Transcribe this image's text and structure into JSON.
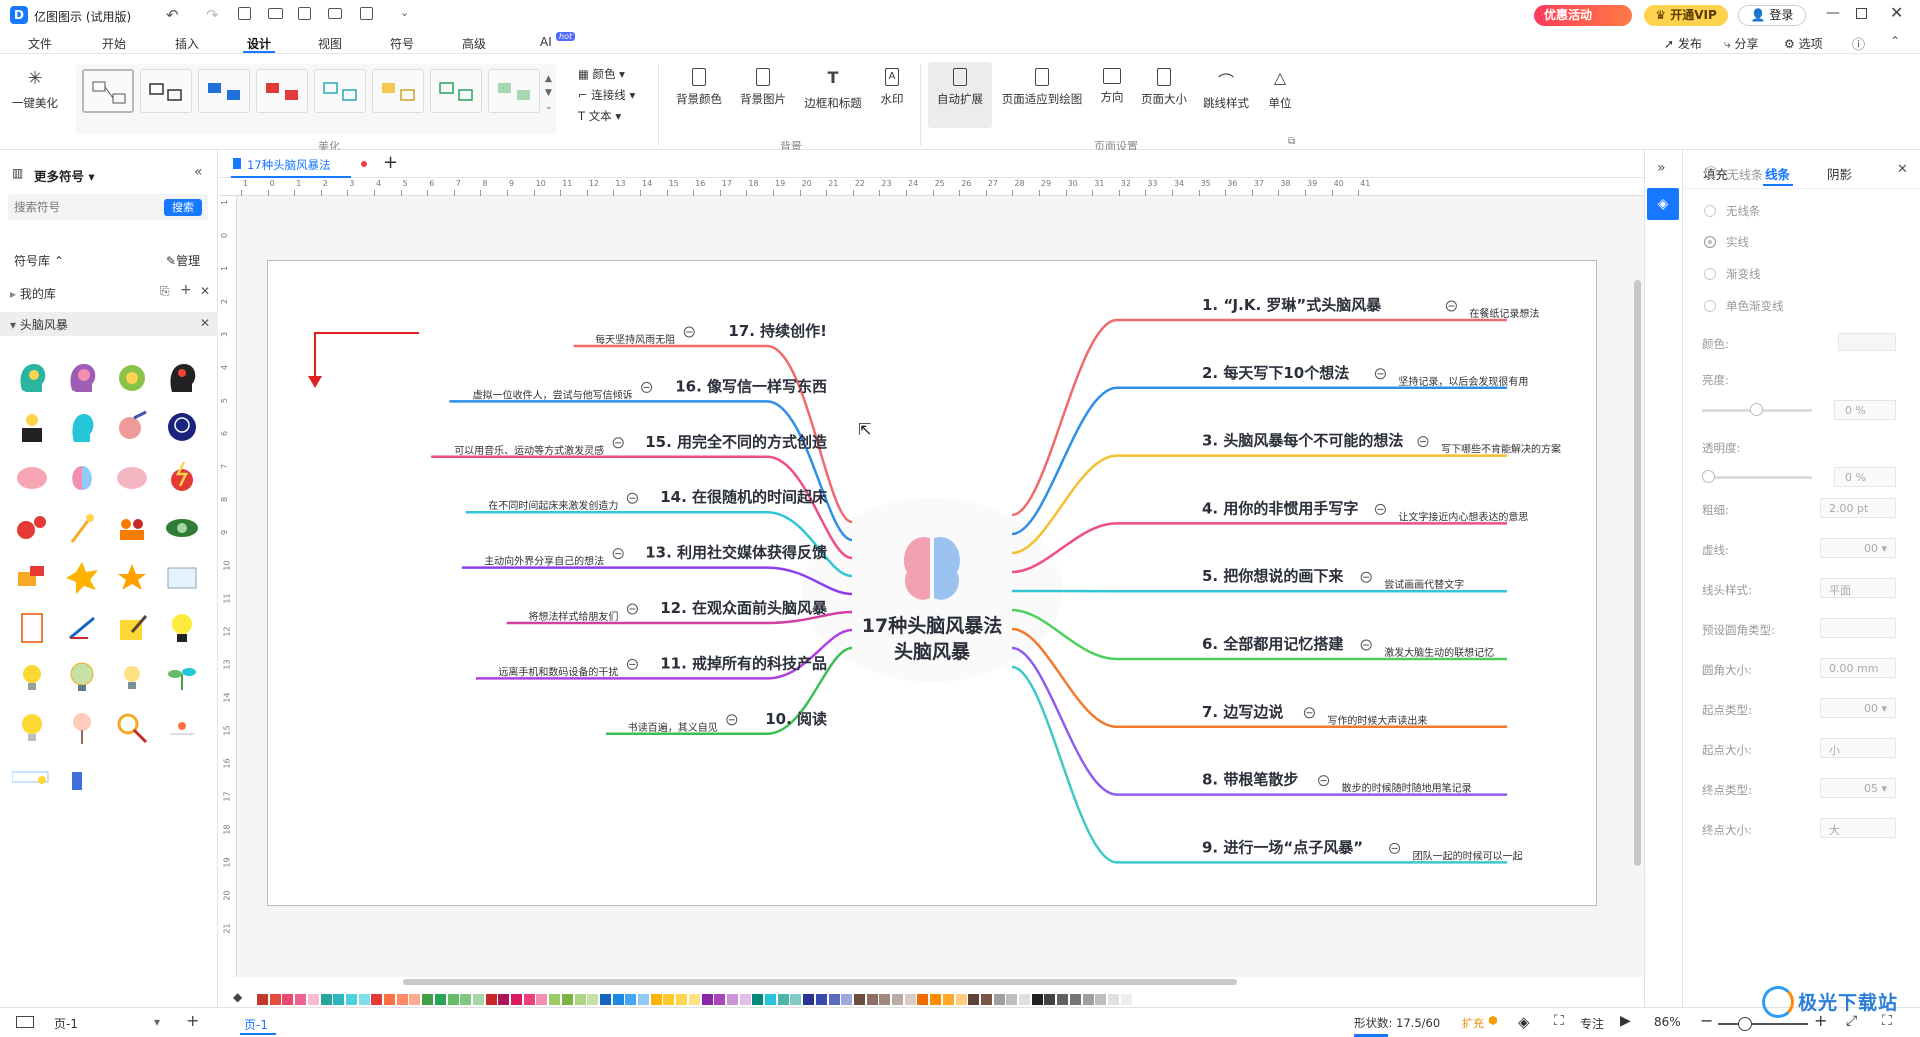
{
  "app": {
    "title": "亿图图示 (试用版)",
    "promo_label": "优惠活动",
    "vip_label": "开通VIP",
    "login_label": "登录",
    "publish_label": "发布",
    "share_label": "分享",
    "options_label": "选项"
  },
  "menu": {
    "items": [
      "文件",
      "开始",
      "插入",
      "设计",
      "视图",
      "符号",
      "高级",
      "AI"
    ],
    "active": "设计",
    "ai_badge": "hot"
  },
  "ribbon": {
    "beautify_label": "一键美化",
    "group_beautify": "美化",
    "color_label": "颜色",
    "connector_label": "连接线",
    "text_label": "文本",
    "bg_color_label": "背景颜色",
    "bg_image_label": "背景图片",
    "border_title_label": "边框和标题",
    "watermark_label": "水印",
    "group_background": "背景",
    "auto_expand_label": "自动扩展",
    "fit_page_label": "页面适应到绘图",
    "direction_label": "方向",
    "page_size_label": "页面大小",
    "jump_style_label": "跳线样式",
    "unit_label": "单位",
    "group_page_setup": "页面设置"
  },
  "left_panel": {
    "header": "更多符号",
    "search_placeholder": "搜索符号",
    "search_button": "搜索",
    "library_label": "符号库",
    "manage_label": "管理",
    "my_library": "我的库",
    "category": "头脑风暴"
  },
  "doc_tab": {
    "title": "17种头脑风暴法"
  },
  "ruler": {
    "h_ticks": [
      "1",
      "0",
      "1",
      "2",
      "3",
      "4",
      "5",
      "6",
      "7",
      "8",
      "9",
      "10",
      "11",
      "12",
      "13",
      "14",
      "15",
      "16",
      "17",
      "18",
      "19",
      "20",
      "21",
      "22",
      "23",
      "24",
      "25",
      "26",
      "27",
      "28",
      "29",
      "30",
      "31",
      "32",
      "33",
      "34",
      "35",
      "36",
      "37",
      "38",
      "39",
      "40",
      "41"
    ],
    "v_ticks": [
      "1",
      "0",
      "1",
      "2",
      "3",
      "4",
      "5",
      "6",
      "7",
      "8",
      "9",
      "10",
      "11",
      "12",
      "13",
      "14",
      "15",
      "16",
      "17",
      "18",
      "19",
      "20",
      "21"
    ]
  },
  "mindmap": {
    "center_line1": "17种头脑风暴法",
    "center_line2": "头脑风暴",
    "right_branches": [
      {
        "title": "1. “J.K. 罗琳”式头脑风暴",
        "note": "在餐纸记录想法",
        "color": "#f06a6a"
      },
      {
        "title": "2. 每天写下10个想法",
        "note": "坚持记录，以后会发现很有用",
        "color": "#2f8fe8"
      },
      {
        "title": "3. 头脑风暴每个不可能的想法",
        "note": "写下哪些不肯能解决的方案",
        "color": "#f5c02f"
      },
      {
        "title": "4. 用你的非惯用手写字",
        "note": "让文字接近内心想表达的意思",
        "color": "#f04c85"
      },
      {
        "title": "5. 把你想说的画下来",
        "note": "尝试画画代替文字",
        "color": "#31c6d4"
      },
      {
        "title": "6. 全部都用记忆搭建",
        "note": "激发大脑生动的联想记忆",
        "color": "#4fcf5a"
      },
      {
        "title": "7. 边写边说",
        "note": "写作的时候大声读出来",
        "color": "#f07a30"
      },
      {
        "title": "8. 带根笔散步",
        "note": "散步的时候随时随地用笔记录",
        "color": "#8f5cf0"
      },
      {
        "title": "9. 进行一场“点子风暴”",
        "note": "团队一起的时候可以一起",
        "color": "#3fc8c8"
      }
    ],
    "left_branches": [
      {
        "title": "17. 持续创作!",
        "note": "每天坚持风雨无阻",
        "color": "#f06a6a"
      },
      {
        "title": "16. 像写信一样写东西",
        "note": "虚拟一位收件人，尝试与他写信倾诉",
        "color": "#2f8fe8"
      },
      {
        "title": "15. 用完全不同的方式创造",
        "note": "可以用音乐、运动等方式激发灵感",
        "color": "#f04c85"
      },
      {
        "title": "14. 在很随机的时间起床",
        "note": "在不同时间起床来激发创造力",
        "color": "#31c6d4"
      },
      {
        "title": "13. 利用社交媒体获得反馈",
        "note": "主动向外界分享自己的想法",
        "color": "#8f3cf0"
      },
      {
        "title": "12. 在观众面前头脑风暴",
        "note": "将想法样式给朋友们",
        "color": "#d040a0"
      },
      {
        "title": "11. 戒掉所有的科技产品",
        "note": "远离手机和数码设备的干扰",
        "color": "#b040e0"
      },
      {
        "title": "10. 阅读",
        "note": "书读百遍，其义自见",
        "color": "#38c050"
      }
    ]
  },
  "right_panel": {
    "tabs": [
      "填充",
      "线条",
      "阴影"
    ],
    "active_tab": "线条",
    "options": [
      "无线条",
      "实线",
      "渐变线",
      "单色渐变线"
    ],
    "color_label": "颜色:",
    "brightness_label": "亮度:",
    "brightness_value": "0 %",
    "transparency_label": "透明度:",
    "transparency_value": "0 %",
    "width_label": "粗细:",
    "width_value": "2.00 pt",
    "dash_label": "虚线:",
    "dash_value": "00",
    "cap_label": "线头样式:",
    "cap_value": "平面",
    "corner_type_label": "预设圆角类型:",
    "corner_size_label": "圆角大小:",
    "corner_size_value": "0.00 mm",
    "start_type_label": "起点类型:",
    "start_type_value": "00",
    "start_size_label": "起点大小:",
    "start_size_value": "小",
    "end_type_label": "终点类型:",
    "end_type_value": "05",
    "end_size_label": "终点大小:",
    "end_size_value": "大"
  },
  "status": {
    "page_selector": "页-1",
    "page_tab": "页-1",
    "shape_count": "形状数: 17.5/60",
    "expand_label": "扩充",
    "focus_label": "专注",
    "zoom": "86%",
    "watermark": "极光下载站"
  },
  "palette": [
    "#c0392b",
    "#e74c3c",
    "#e84a6f",
    "#f06292",
    "#f8bbd0",
    "#26a69a",
    "#2bb5c0",
    "#4dd0e1",
    "#80deea",
    "#e53935",
    "#ff7043",
    "#ff8a65",
    "#ffab91",
    "#43a047",
    "#26a65b",
    "#66bb6a",
    "#81c784",
    "#a5d6a7",
    "#c62828",
    "#ad1457",
    "#d81b60",
    "#ec407a",
    "#f48fb1",
    "#9ccc65",
    "#7cb342",
    "#aed581",
    "#c5e1a5",
    "#1565c0",
    "#1e88e5",
    "#42a5f5",
    "#90caf9",
    "#ffb300",
    "#ffca28",
    "#ffd54f",
    "#ffe082",
    "#8e24aa",
    "#ab47bc",
    "#ce93d8",
    "#e1bee7",
    "#00897b",
    "#26c6da",
    "#4db6ac",
    "#80cbc4",
    "#283593",
    "#3949ab",
    "#5c6bc0",
    "#9fa8da",
    "#6d4c41",
    "#8d6e63",
    "#a1887f",
    "#bcaaa4",
    "#d7ccc8",
    "#ef6c00",
    "#fb8c00",
    "#ffa726",
    "#ffcc80",
    "#5d4037",
    "#795548",
    "#9e9e9e",
    "#bdbdbd",
    "#e0e0e0",
    "#212121",
    "#424242",
    "#616161",
    "#757575",
    "#9e9e9e",
    "#bdbdbd",
    "#e0e0e0",
    "#eeeeee"
  ]
}
